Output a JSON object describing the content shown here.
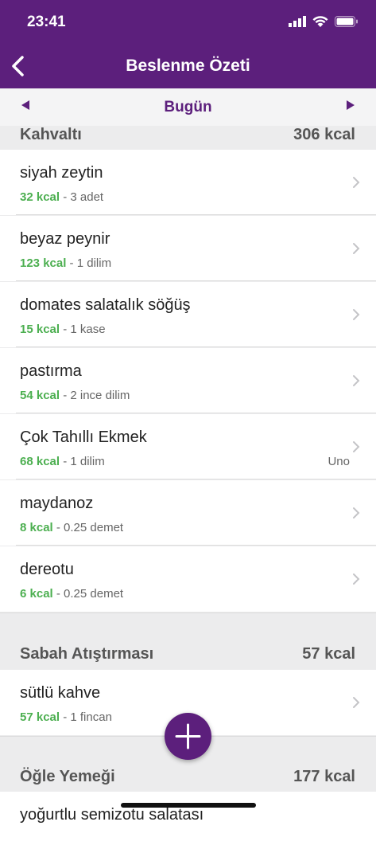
{
  "status_bar": {
    "time": "23:41"
  },
  "nav": {
    "title": "Beslenme Özeti"
  },
  "date_bar": {
    "label": "Bugün"
  },
  "meals": [
    {
      "name": "Kahvaltı",
      "kcal": "306 kcal",
      "items": [
        {
          "food": "siyah zeytin",
          "kcal": "32 kcal",
          "portion": " - 3 adet",
          "brand": ""
        },
        {
          "food": "beyaz peynir",
          "kcal": "123 kcal",
          "portion": " - 1 dilim",
          "brand": ""
        },
        {
          "food": "domates salatalık söğüş",
          "kcal": "15 kcal",
          "portion": " - 1 kase",
          "brand": ""
        },
        {
          "food": "pastırma",
          "kcal": "54 kcal",
          "portion": " - 2 ince dilim",
          "brand": ""
        },
        {
          "food": "Çok Tahıllı Ekmek",
          "kcal": "68 kcal",
          "portion": " - 1 dilim",
          "brand": "Uno"
        },
        {
          "food": "maydanoz",
          "kcal": "8 kcal",
          "portion": " - 0.25 demet",
          "brand": ""
        },
        {
          "food": "dereotu",
          "kcal": "6 kcal",
          "portion": " - 0.25 demet",
          "brand": ""
        }
      ]
    },
    {
      "name": "Sabah Atıştırması",
      "kcal": "57 kcal",
      "items": [
        {
          "food": "sütlü kahve",
          "kcal": "57 kcal",
          "portion": " - 1 fincan",
          "brand": ""
        }
      ]
    },
    {
      "name": "Öğle Yemeği",
      "kcal": "177 kcal",
      "items": [
        {
          "food": "yoğurtlu semizotu salatası",
          "kcal": "",
          "portion": "",
          "brand": ""
        }
      ]
    }
  ],
  "colors": {
    "primary": "#5c1f7c",
    "kcal_green": "#4caf50"
  },
  "icons": {
    "back": "chevron-left-icon",
    "prev": "triangle-left-icon",
    "next": "triangle-right-icon",
    "add": "plus-icon",
    "row": "chevron-right-icon"
  }
}
